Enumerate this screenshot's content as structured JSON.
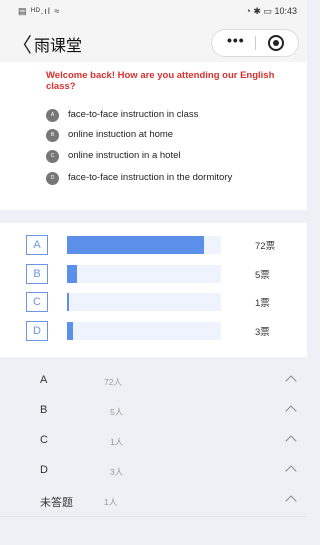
{
  "status": {
    "left": "▤ ᴴᴰ.ıl ≈",
    "right": "◔ ✱ ▭ 10:43"
  },
  "nav": {
    "back_glyph": "〈",
    "title": "雨课堂",
    "menu_glyph": "•••"
  },
  "question": {
    "text": "Welcome back! How are you attending our English class?",
    "options": [
      {
        "key": "A",
        "text": "face-to-face instruction in class"
      },
      {
        "key": "B",
        "text": "online instuction at home"
      },
      {
        "key": "C",
        "text": "online instruction in a hotel"
      },
      {
        "key": "D",
        "text": "face-to-face instruction in the dormitory"
      }
    ]
  },
  "results": [
    {
      "label": "A",
      "votes": 72,
      "votes_text": "72票"
    },
    {
      "label": "B",
      "votes": 5,
      "votes_text": "5票"
    },
    {
      "label": "C",
      "votes": 1,
      "votes_text": "1票"
    },
    {
      "label": "D",
      "votes": 3,
      "votes_text": "3票"
    }
  ],
  "answers": [
    {
      "label": "A",
      "count": "72人"
    },
    {
      "label": "B",
      "count": "5人"
    },
    {
      "label": "C",
      "count": "1人"
    },
    {
      "label": "D",
      "count": "3人"
    },
    {
      "label": "未答题",
      "count": "1人"
    }
  ],
  "colors": {
    "accent": "#5b8fea",
    "question": "#d9302f"
  }
}
